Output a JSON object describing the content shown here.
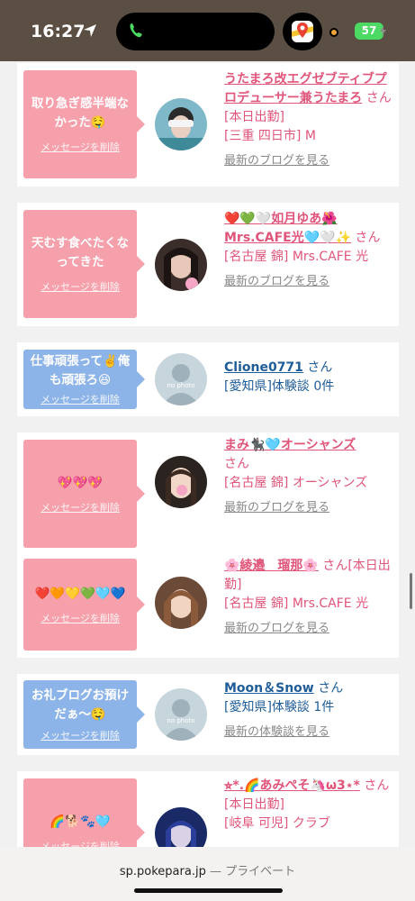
{
  "status": {
    "time": "16:27",
    "battery": "57"
  },
  "cards": [
    {
      "message": "取り急ぎ感半端なかった🤤",
      "delete_label": "メッセージを削除",
      "name": "うたまろ改エグゼブティブプロデューサー兼うたまろ",
      "suffix": "さん[本日出勤]",
      "shop": "[三重 四日市] M",
      "more": "最新のブログを見る",
      "bubble_color": "pink"
    },
    {
      "message": "天むす食べたくなってきた",
      "delete_label": "メッセージを削除",
      "name": "❤️💚🤍如月ゆあ🌺Mrs.CAFE光🩵🤍✨",
      "suffix": "さん",
      "shop": "[名古屋 錦] Mrs.CAFE 光",
      "more": "最新のブログを見る",
      "bubble_color": "pink"
    },
    {
      "message": "仕事頑張って✌️俺も頑張ろ😆",
      "delete_label": "メッセージを削除",
      "name": "Clione0771",
      "suffix": "さん",
      "shop": "[愛知県]体験談 0件",
      "more": "",
      "bubble_color": "blue"
    },
    {
      "message": "💖💖💖",
      "delete_label": "メッセージを削除",
      "name": "まみ🐈‍⬛🩵オーシャンズ",
      "suffix": "さん",
      "shop": "[名古屋 錦] オーシャンズ",
      "more": "最新のブログを見る",
      "bubble_color": "pink"
    },
    {
      "message": "❤️🧡💛💚🩵💙",
      "delete_label": "メッセージを削除",
      "name": "🌸綾邉　瑠那🌸",
      "suffix": "さん[本日出勤]",
      "shop": "[名古屋 錦] Mrs.CAFE 光",
      "more": "最新のブログを見る",
      "bubble_color": "pink"
    },
    {
      "message": "お礼ブログお預けだぁ〜🤤",
      "delete_label": "メッセージを削除",
      "name": "Moon＆Snow",
      "suffix": "さん",
      "shop": "[愛知県]体験談 1件",
      "more": "最新の体験談を見る",
      "bubble_color": "blue"
    },
    {
      "message": "🌈🐕🐾🩵",
      "delete_label": "メッセージを削除",
      "name": "⭐︎*.🌈あみぺそ🦄ω3⋆*",
      "suffix": "さん[本日出勤]",
      "shop": "[岐阜 可児] クラブ",
      "more": "",
      "bubble_color": "pink"
    }
  ],
  "no_photo_text": "no photo",
  "browser": {
    "domain": "sp.pokepara.jp",
    "sep": "—",
    "mode": "プライベート"
  }
}
